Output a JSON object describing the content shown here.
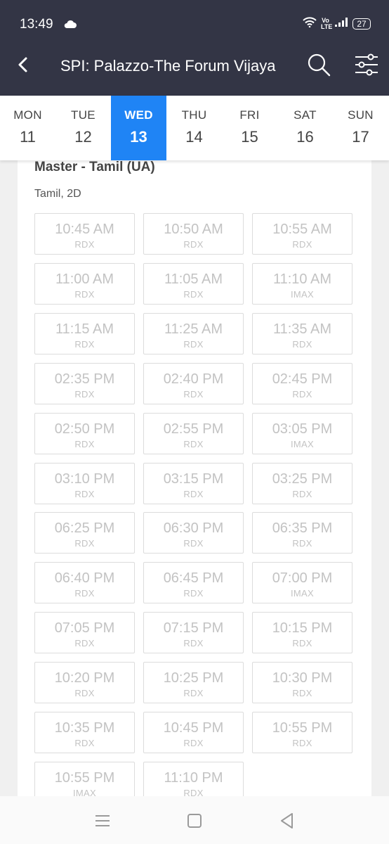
{
  "status_bar": {
    "time": "13:49",
    "battery": "27",
    "volte_line1": "Vo",
    "volte_line2": "LTE",
    "icons": [
      "cloud-icon",
      "wifi-icon",
      "signal-icon",
      "battery-icon"
    ]
  },
  "header": {
    "title": "SPI: Palazzo-The Forum Vijaya",
    "icons": [
      "back-arrow-icon",
      "search-icon",
      "filter-sliders-icon"
    ],
    "background": "#333545"
  },
  "dates": [
    {
      "day": "MON",
      "date": "11",
      "selected": false
    },
    {
      "day": "TUE",
      "date": "12",
      "selected": false
    },
    {
      "day": "WED",
      "date": "13",
      "selected": true
    },
    {
      "day": "THU",
      "date": "14",
      "selected": false
    },
    {
      "day": "FRI",
      "date": "15",
      "selected": false
    },
    {
      "day": "SAT",
      "date": "16",
      "selected": false
    },
    {
      "day": "SUN",
      "date": "17",
      "selected": false
    }
  ],
  "accent_color": "#1f84f5",
  "movie": {
    "title": "Master - Tamil (UA)",
    "meta": "Tamil, 2D"
  },
  "showtimes": [
    {
      "time": "10:45 AM",
      "format": "RDX"
    },
    {
      "time": "10:50 AM",
      "format": "RDX"
    },
    {
      "time": "10:55 AM",
      "format": "RDX"
    },
    {
      "time": "11:00 AM",
      "format": "RDX"
    },
    {
      "time": "11:05 AM",
      "format": "RDX"
    },
    {
      "time": "11:10 AM",
      "format": "IMAX"
    },
    {
      "time": "11:15 AM",
      "format": "RDX"
    },
    {
      "time": "11:25 AM",
      "format": "RDX"
    },
    {
      "time": "11:35 AM",
      "format": "RDX"
    },
    {
      "time": "02:35 PM",
      "format": "RDX"
    },
    {
      "time": "02:40 PM",
      "format": "RDX"
    },
    {
      "time": "02:45 PM",
      "format": "RDX"
    },
    {
      "time": "02:50 PM",
      "format": "RDX"
    },
    {
      "time": "02:55 PM",
      "format": "RDX"
    },
    {
      "time": "03:05 PM",
      "format": "IMAX"
    },
    {
      "time": "03:10 PM",
      "format": "RDX"
    },
    {
      "time": "03:15 PM",
      "format": "RDX"
    },
    {
      "time": "03:25 PM",
      "format": "RDX"
    },
    {
      "time": "06:25 PM",
      "format": "RDX"
    },
    {
      "time": "06:30 PM",
      "format": "RDX"
    },
    {
      "time": "06:35 PM",
      "format": "RDX"
    },
    {
      "time": "06:40 PM",
      "format": "RDX"
    },
    {
      "time": "06:45 PM",
      "format": "RDX"
    },
    {
      "time": "07:00 PM",
      "format": "IMAX"
    },
    {
      "time": "07:05 PM",
      "format": "RDX"
    },
    {
      "time": "07:15 PM",
      "format": "RDX"
    },
    {
      "time": "10:15 PM",
      "format": "RDX"
    },
    {
      "time": "10:20 PM",
      "format": "RDX"
    },
    {
      "time": "10:25 PM",
      "format": "RDX"
    },
    {
      "time": "10:30 PM",
      "format": "RDX"
    },
    {
      "time": "10:35 PM",
      "format": "RDX"
    },
    {
      "time": "10:45 PM",
      "format": "RDX"
    },
    {
      "time": "10:55 PM",
      "format": "RDX"
    },
    {
      "time": "10:55 PM",
      "format": "IMAX"
    },
    {
      "time": "11:10 PM",
      "format": "RDX"
    }
  ],
  "nav_bar": {
    "icons": [
      "menu-icon",
      "home-square-icon",
      "back-triangle-icon"
    ]
  }
}
